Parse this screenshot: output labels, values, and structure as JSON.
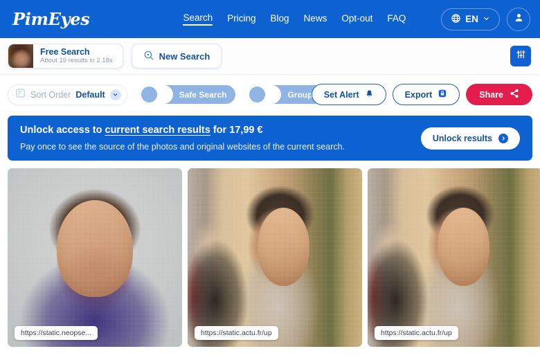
{
  "header": {
    "logo": "PimEyes",
    "nav": [
      {
        "label": "Search",
        "active": true
      },
      {
        "label": "Pricing",
        "active": false
      },
      {
        "label": "Blog",
        "active": false
      },
      {
        "label": "News",
        "active": false
      },
      {
        "label": "Opt-out",
        "active": false
      },
      {
        "label": "FAQ",
        "active": false
      }
    ],
    "language": "EN",
    "language_icon": "globe-icon",
    "chevron_icon": "chevron-down-icon",
    "account_icon": "user-avatar-icon",
    "background_color": "#0d61d0"
  },
  "search_bar": {
    "free_search_title": "Free Search",
    "free_search_subtitle": "About 19 results in 2.18s",
    "thumbnail_icon": "query-face-thumbnail",
    "new_search_label": "New Search",
    "new_search_icon": "search-plus-icon",
    "filter_icon": "sliders-filter-icon"
  },
  "controls": {
    "sort_icon": "sort-order-icon",
    "sort_label": "Sort Order",
    "sort_value": "Default",
    "sort_chevron_icon": "chevron-down-icon",
    "toggles": [
      {
        "label": "Safe Search",
        "on": false
      },
      {
        "label": "Grouping",
        "on": false
      }
    ],
    "set_alert_label": "Set Alert",
    "set_alert_icon": "bell-icon",
    "export_label": "Export",
    "export_icon": "lock-badge-icon",
    "share_label": "Share",
    "share_icon": "share-nodes-icon",
    "share_color": "#e31e4d"
  },
  "banner": {
    "title_part1": "Unlock access to ",
    "title_highlight": "current search results",
    "title_part2": " for 17,99 €",
    "subtitle": "Pay once to see the source of the photos and original websites of the current search.",
    "button_label": "Unlock results",
    "button_icon": "arrow-circle-icon",
    "price": "17,99 €",
    "background_color": "#0d61d0"
  },
  "results": [
    {
      "url": "https://static.neopse...",
      "style": "portrait-grey"
    },
    {
      "url": "https://static.actu.fr/up",
      "style": "indoor-warm"
    },
    {
      "url": "https://static.actu.fr/up",
      "style": "indoor-warm"
    }
  ]
}
